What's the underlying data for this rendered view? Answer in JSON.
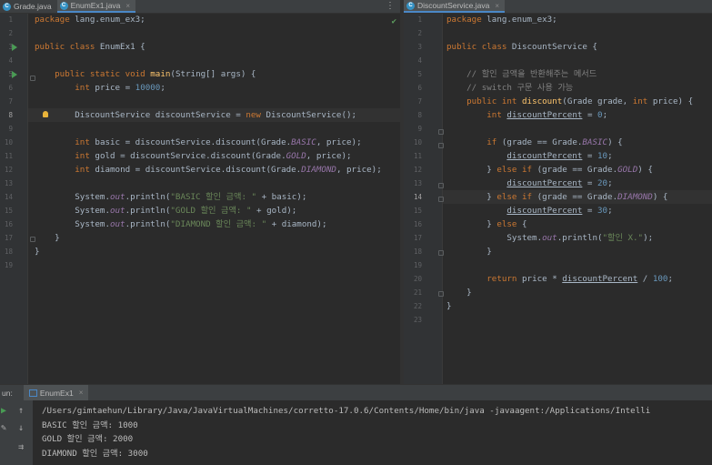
{
  "left_tabs": [
    {
      "label": "Grade.java",
      "active": false
    },
    {
      "label": "EnumEx1.java",
      "active": true
    }
  ],
  "right_tabs": [
    {
      "label": "DiscountService.java",
      "active": true
    }
  ],
  "left_editor": {
    "current_line": 8,
    "line_numbers": [
      "1",
      "2",
      "3",
      "4",
      "5",
      "6",
      "7",
      "8",
      "9",
      "10",
      "11",
      "12",
      "13",
      "14",
      "15",
      "16",
      "17",
      "18",
      "19"
    ]
  },
  "right_editor": {
    "current_line": 14,
    "line_numbers": [
      "1",
      "2",
      "3",
      "4",
      "5",
      "6",
      "7",
      "8",
      "9",
      "10",
      "11",
      "12",
      "13",
      "14",
      "15",
      "16",
      "17",
      "18",
      "19",
      "20",
      "21",
      "22",
      "23"
    ]
  },
  "run_panel": {
    "label": "un:",
    "tab": "EnumEx1",
    "output": [
      "/Users/gimtaehun/Library/Java/JavaVirtualMachines/corretto-17.0.6/Contents/Home/bin/java -javaagent:/Applications/Intelli",
      "BASIC 할인 금액: 1000",
      "GOLD 할인 금액: 2000",
      "DIAMOND 할인 금액: 3000"
    ]
  },
  "icons": {
    "file": "java-class-icon",
    "run": "run-gutter-icon",
    "bulb": "intention-bulb-icon",
    "inspection": "check-icon",
    "menu": "more-vertical-icon"
  },
  "colors": {
    "background": "#2b2b2b",
    "keyword": "#cc7832",
    "method": "#ffc66d",
    "number": "#6897bb",
    "string": "#6a8759",
    "comment": "#808080",
    "constant": "#9876aa",
    "text": "#a9b7c6"
  }
}
